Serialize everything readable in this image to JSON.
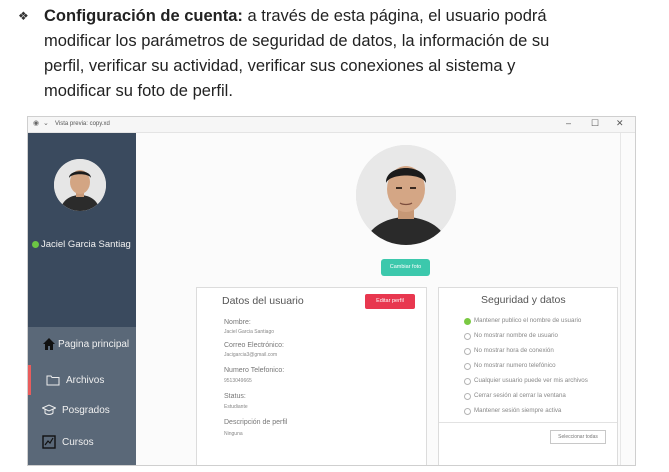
{
  "document": {
    "bullet_symbol": "❖",
    "heading": "Configuración de cuenta:",
    "line1_rest": "a través de esta página, el usuario podrá",
    "line2": "modificar los parámetros de seguridad de datos, la información de su",
    "line3": "perfil, verificar su actividad, verificar sus conexiones al sistema y",
    "line4": "modificar su foto de perfil."
  },
  "window": {
    "title": "Vista previa: copy.xd",
    "minimize": "–",
    "maximize": "☐",
    "close": "✕"
  },
  "sidebar": {
    "user_name": "Jaciel Garcia Santiag",
    "status_color": "#6cc644",
    "items": [
      {
        "label": "Pagina principal",
        "icon": "home-icon"
      },
      {
        "label": "Archivos",
        "icon": "folder-icon"
      },
      {
        "label": "Posgrados",
        "icon": "graduation-cap-icon"
      },
      {
        "label": "Cursos",
        "icon": "chart-icon"
      }
    ]
  },
  "profile": {
    "change_photo_button": "Cambiar foto"
  },
  "user_panel": {
    "title": "Datos del usuario",
    "edit_button": "Editar perfil",
    "fields": [
      {
        "label": "Nombre:",
        "value": "Jaciel Garcia Santiago"
      },
      {
        "label": "Correo Electrónico:",
        "value": "Jacigarcia3@gmail.com"
      },
      {
        "label": "Numero Telefonico:",
        "value": "9513049665"
      },
      {
        "label": "Status:",
        "value": "Estudiante"
      },
      {
        "label": "Descripción de perfil",
        "value": "Ninguna"
      }
    ]
  },
  "security_panel": {
    "title": "Seguridad y datos",
    "options": [
      {
        "label": "Mantener publico el nombre de usuario",
        "selected": true
      },
      {
        "label": "No mostrar nombre de usuario",
        "selected": false
      },
      {
        "label": "No mostrar hora de conexión",
        "selected": false
      },
      {
        "label": "No mostrar numero telefónico",
        "selected": false
      },
      {
        "label": "Cualquier usuario puede ver mis archivos",
        "selected": false
      },
      {
        "label": "Cerrar sesión al cerrar la ventana",
        "selected": false
      },
      {
        "label": "Mantener sesión siempre activa",
        "selected": false
      }
    ],
    "select_all_button": "Seleccionar todas"
  },
  "colors": {
    "sidebar_bg": "#3a4a5e",
    "menu_bg": "#5a6878",
    "accent_green": "#3cc8ac",
    "edit_red": "#e8374f"
  }
}
